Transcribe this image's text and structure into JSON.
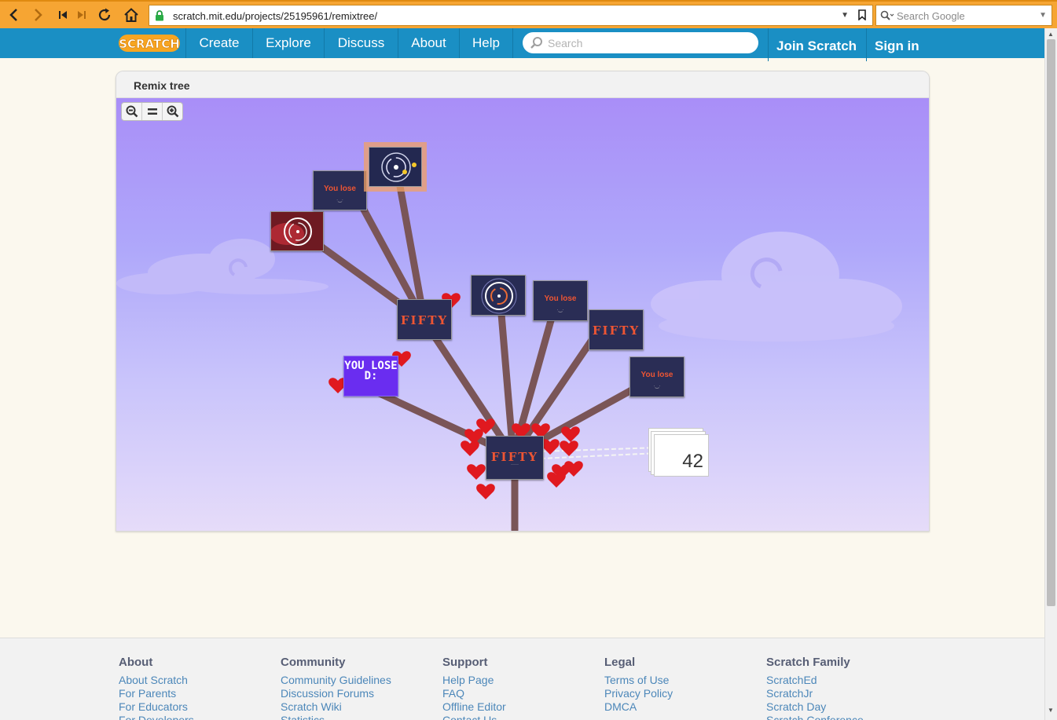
{
  "browser": {
    "url": "scratch.mit.edu/projects/25195961/remixtree/",
    "google_placeholder": "Search Google"
  },
  "nav": {
    "links": [
      "Create",
      "Explore",
      "Discuss",
      "About",
      "Help"
    ],
    "search_placeholder": "Search",
    "join": "Join Scratch",
    "signin": "Sign in"
  },
  "remix": {
    "title": "Remix tree",
    "thumbs": {
      "fifty": "FIFTY",
      "you_lose": "You lose",
      "you_lose_big": "YOU LOSE D:"
    },
    "more_count": "42"
  },
  "footer": {
    "columns": [
      {
        "title": "About",
        "links": [
          "About Scratch",
          "For Parents",
          "For Educators",
          "For Developers"
        ]
      },
      {
        "title": "Community",
        "links": [
          "Community Guidelines",
          "Discussion Forums",
          "Scratch Wiki",
          "Statistics"
        ]
      },
      {
        "title": "Support",
        "links": [
          "Help Page",
          "FAQ",
          "Offline Editor",
          "Contact Us"
        ]
      },
      {
        "title": "Legal",
        "links": [
          "Terms of Use",
          "Privacy Policy",
          "DMCA"
        ]
      },
      {
        "title": "Scratch Family",
        "links": [
          "ScratchEd",
          "ScratchJr",
          "Scratch Day",
          "Scratch Conference"
        ]
      }
    ]
  },
  "colors": {
    "browser_bar": "#f6a533",
    "scratch_blue": "#1a8fc4",
    "branch": "#7a5557",
    "heart": "#e0191f"
  }
}
